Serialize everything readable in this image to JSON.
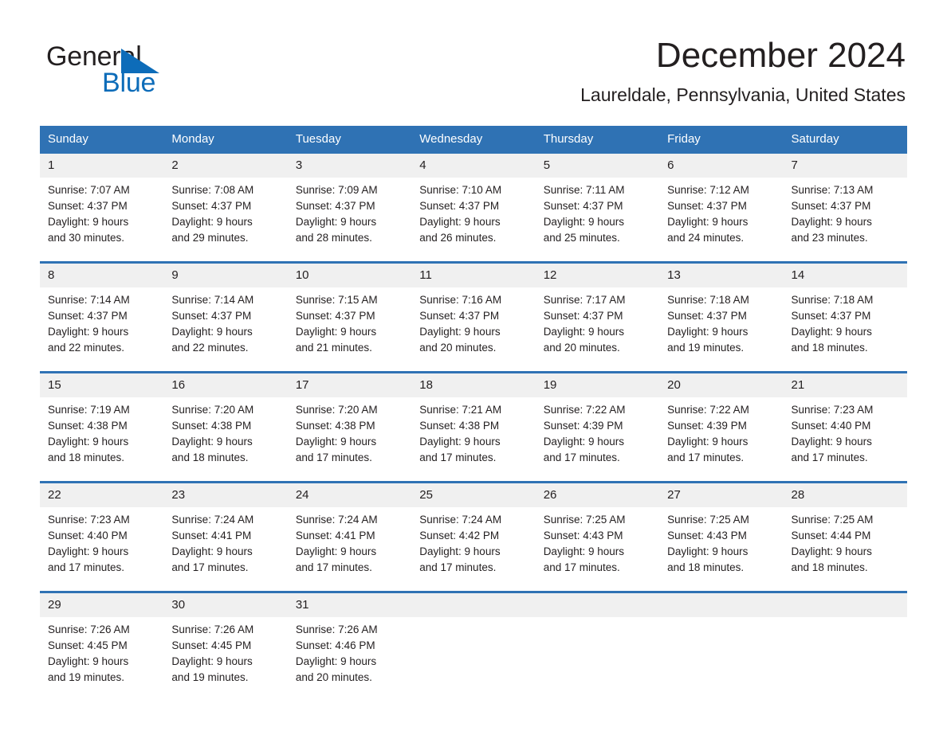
{
  "brand": {
    "name_part1": "General",
    "name_part2": "Blue",
    "triangle_color": "#0d6cb9",
    "text_color": "#231f20"
  },
  "header": {
    "month_title": "December 2024",
    "location": "Laureldale, Pennsylvania, United States"
  },
  "theme": {
    "header_row_color": "#2f72b4",
    "day_number_band_color": "#f0f0f0",
    "page_background": "#ffffff"
  },
  "calendar": {
    "weekday_headers": [
      "Sunday",
      "Monday",
      "Tuesday",
      "Wednesday",
      "Thursday",
      "Friday",
      "Saturday"
    ],
    "weeks": [
      [
        {
          "day": "1",
          "sunrise": "Sunrise: 7:07 AM",
          "sunset": "Sunset: 4:37 PM",
          "daylight_line1": "Daylight: 9 hours",
          "daylight_line2": "and 30 minutes."
        },
        {
          "day": "2",
          "sunrise": "Sunrise: 7:08 AM",
          "sunset": "Sunset: 4:37 PM",
          "daylight_line1": "Daylight: 9 hours",
          "daylight_line2": "and 29 minutes."
        },
        {
          "day": "3",
          "sunrise": "Sunrise: 7:09 AM",
          "sunset": "Sunset: 4:37 PM",
          "daylight_line1": "Daylight: 9 hours",
          "daylight_line2": "and 28 minutes."
        },
        {
          "day": "4",
          "sunrise": "Sunrise: 7:10 AM",
          "sunset": "Sunset: 4:37 PM",
          "daylight_line1": "Daylight: 9 hours",
          "daylight_line2": "and 26 minutes."
        },
        {
          "day": "5",
          "sunrise": "Sunrise: 7:11 AM",
          "sunset": "Sunset: 4:37 PM",
          "daylight_line1": "Daylight: 9 hours",
          "daylight_line2": "and 25 minutes."
        },
        {
          "day": "6",
          "sunrise": "Sunrise: 7:12 AM",
          "sunset": "Sunset: 4:37 PM",
          "daylight_line1": "Daylight: 9 hours",
          "daylight_line2": "and 24 minutes."
        },
        {
          "day": "7",
          "sunrise": "Sunrise: 7:13 AM",
          "sunset": "Sunset: 4:37 PM",
          "daylight_line1": "Daylight: 9 hours",
          "daylight_line2": "and 23 minutes."
        }
      ],
      [
        {
          "day": "8",
          "sunrise": "Sunrise: 7:14 AM",
          "sunset": "Sunset: 4:37 PM",
          "daylight_line1": "Daylight: 9 hours",
          "daylight_line2": "and 22 minutes."
        },
        {
          "day": "9",
          "sunrise": "Sunrise: 7:14 AM",
          "sunset": "Sunset: 4:37 PM",
          "daylight_line1": "Daylight: 9 hours",
          "daylight_line2": "and 22 minutes."
        },
        {
          "day": "10",
          "sunrise": "Sunrise: 7:15 AM",
          "sunset": "Sunset: 4:37 PM",
          "daylight_line1": "Daylight: 9 hours",
          "daylight_line2": "and 21 minutes."
        },
        {
          "day": "11",
          "sunrise": "Sunrise: 7:16 AM",
          "sunset": "Sunset: 4:37 PM",
          "daylight_line1": "Daylight: 9 hours",
          "daylight_line2": "and 20 minutes."
        },
        {
          "day": "12",
          "sunrise": "Sunrise: 7:17 AM",
          "sunset": "Sunset: 4:37 PM",
          "daylight_line1": "Daylight: 9 hours",
          "daylight_line2": "and 20 minutes."
        },
        {
          "day": "13",
          "sunrise": "Sunrise: 7:18 AM",
          "sunset": "Sunset: 4:37 PM",
          "daylight_line1": "Daylight: 9 hours",
          "daylight_line2": "and 19 minutes."
        },
        {
          "day": "14",
          "sunrise": "Sunrise: 7:18 AM",
          "sunset": "Sunset: 4:37 PM",
          "daylight_line1": "Daylight: 9 hours",
          "daylight_line2": "and 18 minutes."
        }
      ],
      [
        {
          "day": "15",
          "sunrise": "Sunrise: 7:19 AM",
          "sunset": "Sunset: 4:38 PM",
          "daylight_line1": "Daylight: 9 hours",
          "daylight_line2": "and 18 minutes."
        },
        {
          "day": "16",
          "sunrise": "Sunrise: 7:20 AM",
          "sunset": "Sunset: 4:38 PM",
          "daylight_line1": "Daylight: 9 hours",
          "daylight_line2": "and 18 minutes."
        },
        {
          "day": "17",
          "sunrise": "Sunrise: 7:20 AM",
          "sunset": "Sunset: 4:38 PM",
          "daylight_line1": "Daylight: 9 hours",
          "daylight_line2": "and 17 minutes."
        },
        {
          "day": "18",
          "sunrise": "Sunrise: 7:21 AM",
          "sunset": "Sunset: 4:38 PM",
          "daylight_line1": "Daylight: 9 hours",
          "daylight_line2": "and 17 minutes."
        },
        {
          "day": "19",
          "sunrise": "Sunrise: 7:22 AM",
          "sunset": "Sunset: 4:39 PM",
          "daylight_line1": "Daylight: 9 hours",
          "daylight_line2": "and 17 minutes."
        },
        {
          "day": "20",
          "sunrise": "Sunrise: 7:22 AM",
          "sunset": "Sunset: 4:39 PM",
          "daylight_line1": "Daylight: 9 hours",
          "daylight_line2": "and 17 minutes."
        },
        {
          "day": "21",
          "sunrise": "Sunrise: 7:23 AM",
          "sunset": "Sunset: 4:40 PM",
          "daylight_line1": "Daylight: 9 hours",
          "daylight_line2": "and 17 minutes."
        }
      ],
      [
        {
          "day": "22",
          "sunrise": "Sunrise: 7:23 AM",
          "sunset": "Sunset: 4:40 PM",
          "daylight_line1": "Daylight: 9 hours",
          "daylight_line2": "and 17 minutes."
        },
        {
          "day": "23",
          "sunrise": "Sunrise: 7:24 AM",
          "sunset": "Sunset: 4:41 PM",
          "daylight_line1": "Daylight: 9 hours",
          "daylight_line2": "and 17 minutes."
        },
        {
          "day": "24",
          "sunrise": "Sunrise: 7:24 AM",
          "sunset": "Sunset: 4:41 PM",
          "daylight_line1": "Daylight: 9 hours",
          "daylight_line2": "and 17 minutes."
        },
        {
          "day": "25",
          "sunrise": "Sunrise: 7:24 AM",
          "sunset": "Sunset: 4:42 PM",
          "daylight_line1": "Daylight: 9 hours",
          "daylight_line2": "and 17 minutes."
        },
        {
          "day": "26",
          "sunrise": "Sunrise: 7:25 AM",
          "sunset": "Sunset: 4:43 PM",
          "daylight_line1": "Daylight: 9 hours",
          "daylight_line2": "and 17 minutes."
        },
        {
          "day": "27",
          "sunrise": "Sunrise: 7:25 AM",
          "sunset": "Sunset: 4:43 PM",
          "daylight_line1": "Daylight: 9 hours",
          "daylight_line2": "and 18 minutes."
        },
        {
          "day": "28",
          "sunrise": "Sunrise: 7:25 AM",
          "sunset": "Sunset: 4:44 PM",
          "daylight_line1": "Daylight: 9 hours",
          "daylight_line2": "and 18 minutes."
        }
      ],
      [
        {
          "day": "29",
          "sunrise": "Sunrise: 7:26 AM",
          "sunset": "Sunset: 4:45 PM",
          "daylight_line1": "Daylight: 9 hours",
          "daylight_line2": "and 19 minutes."
        },
        {
          "day": "30",
          "sunrise": "Sunrise: 7:26 AM",
          "sunset": "Sunset: 4:45 PM",
          "daylight_line1": "Daylight: 9 hours",
          "daylight_line2": "and 19 minutes."
        },
        {
          "day": "31",
          "sunrise": "Sunrise: 7:26 AM",
          "sunset": "Sunset: 4:46 PM",
          "daylight_line1": "Daylight: 9 hours",
          "daylight_line2": "and 20 minutes."
        },
        {
          "day": "",
          "sunrise": "",
          "sunset": "",
          "daylight_line1": "",
          "daylight_line2": ""
        },
        {
          "day": "",
          "sunrise": "",
          "sunset": "",
          "daylight_line1": "",
          "daylight_line2": ""
        },
        {
          "day": "",
          "sunrise": "",
          "sunset": "",
          "daylight_line1": "",
          "daylight_line2": ""
        },
        {
          "day": "",
          "sunrise": "",
          "sunset": "",
          "daylight_line1": "",
          "daylight_line2": ""
        }
      ]
    ]
  }
}
